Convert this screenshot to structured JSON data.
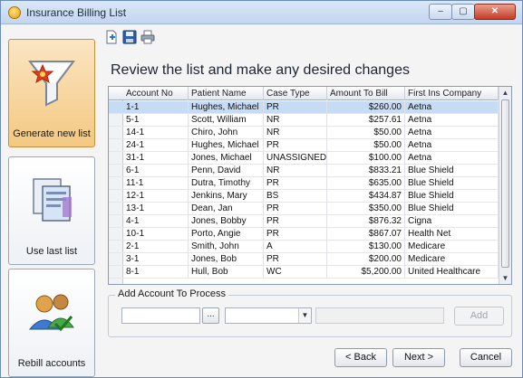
{
  "window": {
    "title": "Insurance Billing List",
    "controls": {
      "minimize": "–",
      "maximize": "▢",
      "close": "✕"
    }
  },
  "sidebar": {
    "items": [
      {
        "label": "Generate new list",
        "icon": "funnel-star-icon",
        "active": true
      },
      {
        "label": "Use last list",
        "icon": "documents-icon",
        "active": false
      },
      {
        "label": "Rebill accounts",
        "icon": "users-check-icon",
        "active": false
      }
    ]
  },
  "toolbar": {
    "icons": [
      "new-document-icon",
      "save-icon",
      "print-icon"
    ]
  },
  "main": {
    "heading": "Review the list and make any desired changes"
  },
  "grid": {
    "columns": [
      "Account No",
      "Patient Name",
      "Case Type",
      "Amount To Bill",
      "First Ins Company"
    ],
    "rows": [
      [
        "1-1",
        "Hughes, Michael",
        "PR",
        "$260.00",
        "Aetna"
      ],
      [
        "5-1",
        "Scott, William",
        "NR",
        "$257.61",
        "Aetna"
      ],
      [
        "14-1",
        "Chiro, John",
        "NR",
        "$50.00",
        "Aetna"
      ],
      [
        "24-1",
        "Hughes, Michael",
        "PR",
        "$50.00",
        "Aetna"
      ],
      [
        "31-1",
        "Jones, Michael",
        "UNASSIGNED",
        "$100.00",
        "Aetna"
      ],
      [
        "6-1",
        "Penn, David",
        "NR",
        "$833.21",
        "Blue Shield"
      ],
      [
        "11-1",
        "Dutra, Timothy",
        "PR",
        "$635.00",
        "Blue Shield"
      ],
      [
        "12-1",
        "Jenkins, Mary",
        "BS",
        "$434.87",
        "Blue Shield"
      ],
      [
        "13-1",
        "Dean, Jan",
        "PR",
        "$350.00",
        "Blue Shield"
      ],
      [
        "4-1",
        "Jones, Bobby",
        "PR",
        "$876.32",
        "Cigna"
      ],
      [
        "10-1",
        "Porto, Angie",
        "PR",
        "$867.07",
        "Health Net"
      ],
      [
        "2-1",
        "Smith, John",
        "A",
        "$130.00",
        "Medicare"
      ],
      [
        "3-1",
        "Jones, Bob",
        "PR",
        "$200.00",
        "Medicare"
      ],
      [
        "8-1",
        "Hull, Bob",
        "WC",
        "$5,200.00",
        "United Healthcare"
      ]
    ],
    "selected_row": 0
  },
  "add_account": {
    "group_label": "Add Account To Process",
    "account_value": "",
    "ellipsis_label": "...",
    "combo_value": "",
    "info_value": "",
    "add_label": "Add"
  },
  "footer": {
    "back_label": "< Back",
    "next_label": "Next >",
    "cancel_label": "Cancel"
  },
  "colors": {
    "selected_row": "#c6dcf5",
    "active_sidebar": "#f3c982",
    "title_bar": "#c2d6ef"
  }
}
